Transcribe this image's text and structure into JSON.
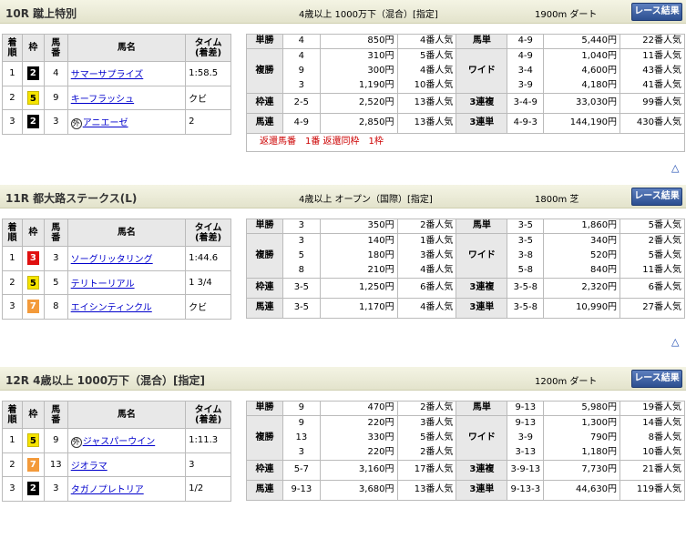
{
  "races": [
    {
      "title": "10R 蹴上特別",
      "conditions": "4歳以上 1000万下（混合）[指定]",
      "distance": "1900m ダート",
      "button": "レース結果",
      "result_headers": [
        "着順",
        "枠",
        "馬番",
        "馬名",
        "タイム(着差)"
      ],
      "results": [
        {
          "pos": "1",
          "frame": "2",
          "fc": "w2",
          "num": "4",
          "name": "サマーサプライズ",
          "foreign": false,
          "time": "1:58.5"
        },
        {
          "pos": "2",
          "frame": "5",
          "fc": "w5",
          "num": "9",
          "name": "キーフラッシュ",
          "foreign": false,
          "time": "クビ"
        },
        {
          "pos": "3",
          "frame": "2",
          "fc": "w2",
          "num": "3",
          "name": "アニエーゼ",
          "foreign": true,
          "time": "2"
        }
      ],
      "payouts": {
        "tansho": {
          "label": "単勝",
          "combo": "4",
          "amount": "850円",
          "pop": "4番人気"
        },
        "fukusho": {
          "label": "複勝",
          "combo": [
            "4",
            "9",
            "3"
          ],
          "amount": [
            "310円",
            "300円",
            "1,190円"
          ],
          "pop": [
            "5番人気",
            "4番人気",
            "10番人気"
          ]
        },
        "wakuren": {
          "label": "枠連",
          "combo": "2-5",
          "amount": "2,520円",
          "pop": "13番人気"
        },
        "umaren": {
          "label": "馬連",
          "combo": "4-9",
          "amount": "2,850円",
          "pop": "13番人気"
        },
        "umatan": {
          "label": "馬単",
          "combo": "4-9",
          "amount": "5,440円",
          "pop": "22番人気"
        },
        "wide": {
          "label": "ワイド",
          "combo": [
            "4-9",
            "3-4",
            "3-9"
          ],
          "amount": [
            "1,040円",
            "4,600円",
            "4,180円"
          ],
          "pop": [
            "11番人気",
            "43番人気",
            "41番人気"
          ]
        },
        "sanrenpuku": {
          "label": "3連複",
          "combo": "3-4-9",
          "amount": "33,030円",
          "pop": "99番人気"
        },
        "sanrentan": {
          "label": "3連単",
          "combo": "4-9-3",
          "amount": "144,190円",
          "pop": "430番人気"
        }
      },
      "note": "返還馬番　1番 返還同枠　1枠"
    },
    {
      "title": "11R 都大路ステークス(L)",
      "conditions": "4歳以上 オープン（国際）[指定]",
      "distance": "1800m 芝",
      "button": "レース結果",
      "result_headers": [
        "着順",
        "枠",
        "馬番",
        "馬名",
        "タイム(着差)"
      ],
      "results": [
        {
          "pos": "1",
          "frame": "3",
          "fc": "w3",
          "num": "3",
          "name": "ソーグリッタリング",
          "foreign": false,
          "time": "1:44.6"
        },
        {
          "pos": "2",
          "frame": "5",
          "fc": "w5",
          "num": "5",
          "name": "テリトーリアル",
          "foreign": false,
          "time": "1 3/4"
        },
        {
          "pos": "3",
          "frame": "7",
          "fc": "w7",
          "num": "8",
          "name": "エイシンティンクル",
          "foreign": false,
          "time": "クビ"
        }
      ],
      "payouts": {
        "tansho": {
          "label": "単勝",
          "combo": "3",
          "amount": "350円",
          "pop": "2番人気"
        },
        "fukusho": {
          "label": "複勝",
          "combo": [
            "3",
            "5",
            "8"
          ],
          "amount": [
            "140円",
            "180円",
            "210円"
          ],
          "pop": [
            "1番人気",
            "3番人気",
            "4番人気"
          ]
        },
        "wakuren": {
          "label": "枠連",
          "combo": "3-5",
          "amount": "1,250円",
          "pop": "6番人気"
        },
        "umaren": {
          "label": "馬連",
          "combo": "3-5",
          "amount": "1,170円",
          "pop": "4番人気"
        },
        "umatan": {
          "label": "馬単",
          "combo": "3-5",
          "amount": "1,860円",
          "pop": "5番人気"
        },
        "wide": {
          "label": "ワイド",
          "combo": [
            "3-5",
            "3-8",
            "5-8"
          ],
          "amount": [
            "340円",
            "520円",
            "840円"
          ],
          "pop": [
            "2番人気",
            "5番人気",
            "11番人気"
          ]
        },
        "sanrenpuku": {
          "label": "3連複",
          "combo": "3-5-8",
          "amount": "2,320円",
          "pop": "6番人気"
        },
        "sanrentan": {
          "label": "3連単",
          "combo": "3-5-8",
          "amount": "10,990円",
          "pop": "27番人気"
        }
      }
    },
    {
      "title": "12R 4歳以上 1000万下（混合）[指定]",
      "conditions": "",
      "distance": "1200m ダート",
      "button": "レース結果",
      "result_headers": [
        "着順",
        "枠",
        "馬番",
        "馬名",
        "タイム(着差)"
      ],
      "results": [
        {
          "pos": "1",
          "frame": "5",
          "fc": "w5",
          "num": "9",
          "name": "ジャスパーウイン",
          "foreign": true,
          "time": "1:11.3"
        },
        {
          "pos": "2",
          "frame": "7",
          "fc": "w7",
          "num": "13",
          "name": "ジオラマ",
          "foreign": false,
          "time": "3"
        },
        {
          "pos": "3",
          "frame": "2",
          "fc": "w2",
          "num": "3",
          "name": "タガノプレトリア",
          "foreign": false,
          "time": "1/2"
        }
      ],
      "payouts": {
        "tansho": {
          "label": "単勝",
          "combo": "9",
          "amount": "470円",
          "pop": "2番人気"
        },
        "fukusho": {
          "label": "複勝",
          "combo": [
            "9",
            "13",
            "3"
          ],
          "amount": [
            "220円",
            "330円",
            "220円"
          ],
          "pop": [
            "3番人気",
            "5番人気",
            "2番人気"
          ]
        },
        "wakuren": {
          "label": "枠連",
          "combo": "5-7",
          "amount": "3,160円",
          "pop": "17番人気"
        },
        "umaren": {
          "label": "馬連",
          "combo": "9-13",
          "amount": "3,680円",
          "pop": "13番人気"
        },
        "umatan": {
          "label": "馬単",
          "combo": "9-13",
          "amount": "5,980円",
          "pop": "19番人気"
        },
        "wide": {
          "label": "ワイド",
          "combo": [
            "9-13",
            "3-9",
            "3-13"
          ],
          "amount": [
            "1,300円",
            "790円",
            "1,180円"
          ],
          "pop": [
            "14番人気",
            "8番人気",
            "10番人気"
          ]
        },
        "sanrenpuku": {
          "label": "3連複",
          "combo": "3-9-13",
          "amount": "7,730円",
          "pop": "21番人気"
        },
        "sanrentan": {
          "label": "3連単",
          "combo": "9-13-3",
          "amount": "44,630円",
          "pop": "119番人気"
        }
      }
    }
  ],
  "foreign_mark": "外",
  "up_icon": "△"
}
